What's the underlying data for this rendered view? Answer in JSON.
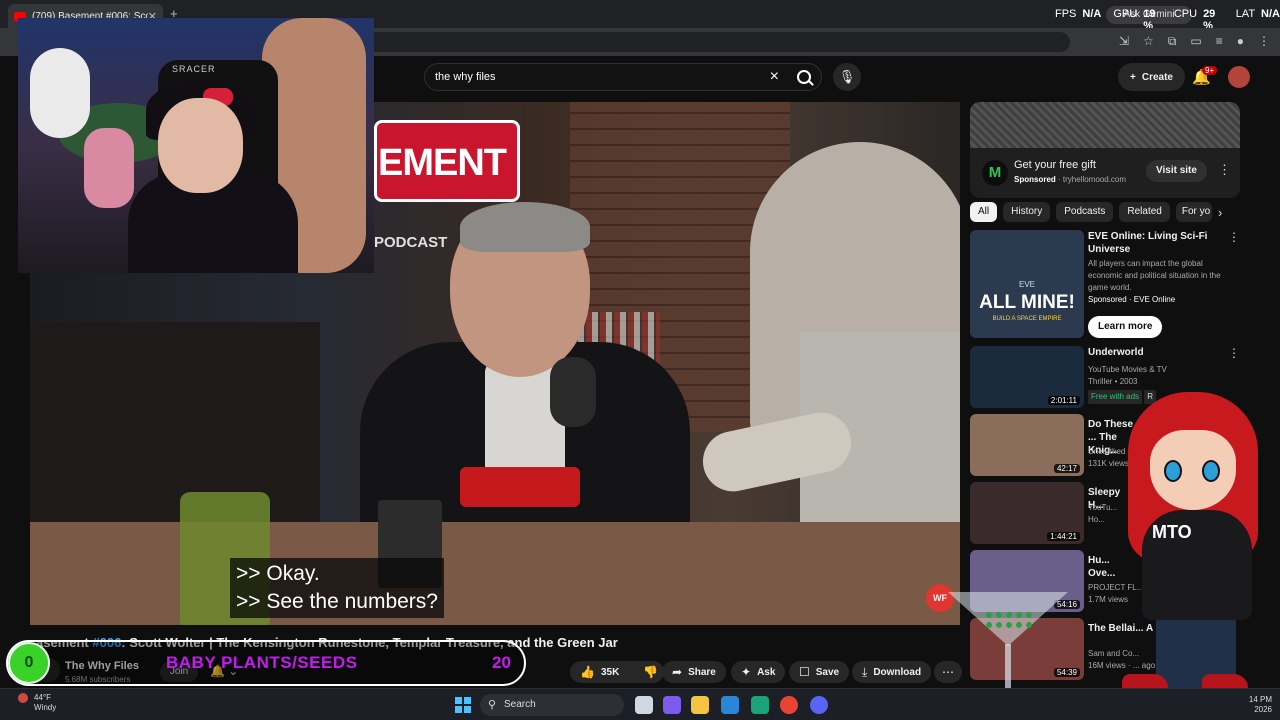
{
  "browser": {
    "tab_title": "(709) Basement #006: Scott W",
    "tab_close": "✕",
    "new_tab": "+",
    "ask_gemini": "Ask Gemini"
  },
  "overlay_stats": {
    "fps_label": "FPS",
    "fps_value": "N/A",
    "gpu_label": "GPU",
    "gpu_value": "19 %",
    "cpu_label": "CPU",
    "cpu_value": "29 %",
    "lat_label": "LAT",
    "lat_value": "N/A"
  },
  "youtube": {
    "search_value": "the why files",
    "create_label": "Create",
    "notif_count": "9+"
  },
  "video": {
    "caption_line1": ">> Okay.",
    "caption_line2": ">> See the numbers?",
    "sign_text": "EMENT",
    "podcast_text": "PODCAST",
    "logo_text": "WF",
    "chair_brand": "SRACER",
    "title_prefix": "asement ",
    "title_tag": "#006",
    "title_rest": ": Scott Wolter | The Kensington Runestone, Templar Treasure, and the Green Jar"
  },
  "channel": {
    "name": "The Why Files",
    "subscribers": "5.68M subscribers",
    "join_label": "Join"
  },
  "actions": {
    "likes": "35K",
    "share": "Share",
    "ask": "Ask",
    "save": "Save",
    "download": "Download"
  },
  "stream_bar": {
    "count_left": "0",
    "text": "BABY PLANTS/SEEDS",
    "count_right": "20"
  },
  "ad": {
    "title": "Get your free gift",
    "sponsored": "Sponsored",
    "domain": "tryhellomood.com",
    "visit_label": "Visit site",
    "logo": "M"
  },
  "chips": [
    "All",
    "History",
    "Podcasts",
    "Related",
    "For yo"
  ],
  "recommendations": [
    {
      "title": "EVE Online: Living Sci-Fi Universe",
      "meta1": "All players can impact the global economic and political situation in the game world.",
      "meta2": "Sponsored · EVE Online",
      "thumb_text": "ALL MINE!",
      "thumb_sub": "BUILD A SPACE EMPIRE",
      "thumb_brand": "EVE",
      "button": "Learn more",
      "thumb_color": "#2b3a4e"
    },
    {
      "title": "Underworld",
      "meta1": "YouTube Movies & TV",
      "meta2": "Thriller • 2003",
      "badge": "Free with ads",
      "badge2": "R",
      "duration": "2:01:11",
      "thumb_color": "#1b2a3d"
    },
    {
      "title": "Do These ... The Knig...",
      "meta1": "Unearthed ...",
      "meta2": "131K views",
      "duration": "42:17",
      "thumb_color": "#8a6d5a"
    },
    {
      "title": "Sleepy H...",
      "meta1": "YouTu...",
      "meta2": "Ho...",
      "duration": "1:44:21",
      "thumb_color": "#3a2a2c"
    },
    {
      "title": "Hu... Ove...",
      "meta1": "PROJECT FL...",
      "meta2": "1.7M views",
      "duration": "54:16",
      "thumb_color": "#6a5f8a"
    },
    {
      "title": "The Bellai... A P... Hell...",
      "meta1": "Sam and Co...",
      "meta2": "16M views · ... ago",
      "duration": "54:39",
      "thumb_color": "#7a3d3a"
    }
  ],
  "mascot": {
    "hoodie_text": "MTO"
  },
  "taskbar": {
    "temp": "44°F",
    "weather": "Windy",
    "search": "Search",
    "time": "14 PM",
    "date": "2026"
  },
  "colors": {
    "accent": "#3ea6ff",
    "stream_text": "#c41cf0",
    "youtube_red": "#ff0000"
  }
}
